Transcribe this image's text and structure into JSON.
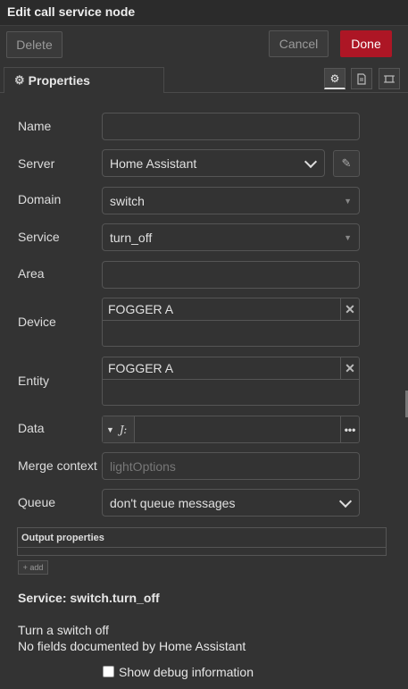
{
  "header": {
    "title": "Edit call service node"
  },
  "actions": {
    "delete": "Delete",
    "cancel": "Cancel",
    "done": "Done"
  },
  "tabs": {
    "properties": "Properties"
  },
  "icons": {
    "settings": "gear-icon",
    "description": "document-icon",
    "appearance": "frame-icon"
  },
  "form": {
    "name": {
      "label": "Name",
      "value": ""
    },
    "server": {
      "label": "Server",
      "value": "Home Assistant"
    },
    "domain": {
      "label": "Domain",
      "value": "switch"
    },
    "service": {
      "label": "Service",
      "value": "turn_off"
    },
    "area": {
      "label": "Area",
      "value": ""
    },
    "device": {
      "label": "Device",
      "value": "FOGGER A"
    },
    "entity": {
      "label": "Entity",
      "value": "FOGGER A"
    },
    "data": {
      "label": "Data",
      "type_icon": "J:"
    },
    "merge_context": {
      "label": "Merge context",
      "placeholder": "lightOptions"
    },
    "queue": {
      "label": "Queue",
      "value": "don't queue messages"
    }
  },
  "output": {
    "header": "Output properties",
    "add": "+ add"
  },
  "service_info": {
    "title": "Service: switch.turn_off",
    "description": "Turn a switch off",
    "fields_note": "No fields documented by Home Assistant"
  },
  "debug": {
    "label": "Show debug information",
    "checked": false
  },
  "colors": {
    "background": "#333333",
    "done": "#ad1625"
  }
}
